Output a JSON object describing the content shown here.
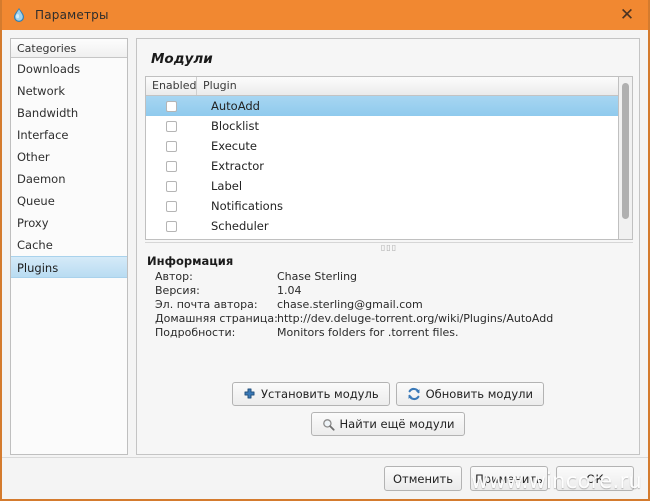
{
  "window": {
    "title": "Параметры",
    "icon": "deluge-droplet-icon",
    "close_label": "✕",
    "accent_color": "#f18831",
    "border_color": "#d47b2e"
  },
  "sidebar": {
    "header": "Categories",
    "items": [
      {
        "label": "Downloads",
        "selected": false
      },
      {
        "label": "Network",
        "selected": false
      },
      {
        "label": "Bandwidth",
        "selected": false
      },
      {
        "label": "Interface",
        "selected": false
      },
      {
        "label": "Other",
        "selected": false
      },
      {
        "label": "Daemon",
        "selected": false
      },
      {
        "label": "Queue",
        "selected": false
      },
      {
        "label": "Proxy",
        "selected": false
      },
      {
        "label": "Cache",
        "selected": false
      },
      {
        "label": "Plugins",
        "selected": true
      }
    ]
  },
  "pane": {
    "title": "Модули",
    "list": {
      "columns": [
        "Enabled",
        "Plugin"
      ],
      "rows": [
        {
          "name": "AutoAdd",
          "enabled": false,
          "selected": true
        },
        {
          "name": "Blocklist",
          "enabled": false,
          "selected": false
        },
        {
          "name": "Execute",
          "enabled": false,
          "selected": false
        },
        {
          "name": "Extractor",
          "enabled": false,
          "selected": false
        },
        {
          "name": "Label",
          "enabled": false,
          "selected": false
        },
        {
          "name": "Notifications",
          "enabled": false,
          "selected": false
        },
        {
          "name": "Scheduler",
          "enabled": false,
          "selected": false
        }
      ],
      "selection_color": "#9ed2f0"
    },
    "info": {
      "title": "Информация",
      "rows": [
        {
          "key": "Автор:",
          "value": "Chase Sterling"
        },
        {
          "key": "Версия:",
          "value": "1.04"
        },
        {
          "key": "Эл. почта автора:",
          "value": "chase.sterling@gmail.com"
        },
        {
          "key": "Домашняя страница:",
          "value": "http://dev.deluge-torrent.org/wiki/Plugins/AutoAdd"
        },
        {
          "key": "Подробности:",
          "value": "Monitors folders for .torrent files."
        }
      ]
    },
    "actions": {
      "install": "Установить модуль",
      "rescan": "Обновить модули",
      "find_more": "Найти ещё модули"
    }
  },
  "footer": {
    "cancel": "Отменить",
    "apply": "Применить",
    "ok": "ОК"
  },
  "watermark": "www.wincore.ru"
}
